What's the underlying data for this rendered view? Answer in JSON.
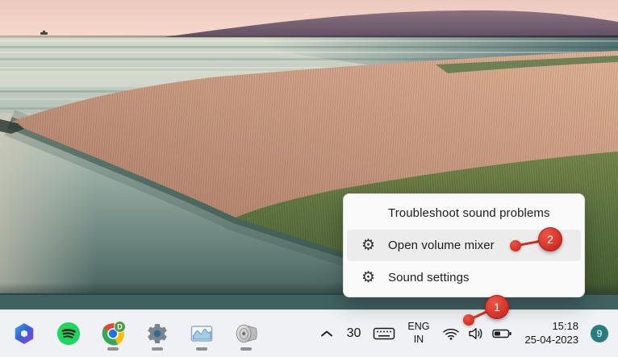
{
  "menu": {
    "items": [
      {
        "label": "Troubleshoot sound problems",
        "has_icon": false,
        "highlighted": false
      },
      {
        "label": "Open volume mixer",
        "has_icon": true,
        "highlighted": true
      },
      {
        "label": "Sound settings",
        "has_icon": true,
        "highlighted": false
      }
    ]
  },
  "taskbar": {
    "pinned_apps": [
      {
        "name": "microsoft-365",
        "running": false
      },
      {
        "name": "spotify",
        "running": false
      },
      {
        "name": "chrome",
        "running": true,
        "badge": "D"
      },
      {
        "name": "settings",
        "running": true
      },
      {
        "name": "task-manager",
        "running": true
      },
      {
        "name": "volume-app",
        "running": true
      }
    ],
    "status_number": "30",
    "language": {
      "line1": "ENG",
      "line2": "IN"
    },
    "clock": {
      "time": "15:18",
      "date": "25-04-2023"
    },
    "notification_count": "9"
  },
  "annotations": {
    "step1": {
      "number": "1"
    },
    "step2": {
      "number": "2"
    }
  },
  "icons": {
    "gear_glyph": "⚙",
    "names": [
      "gear-icon",
      "chevron-up-icon",
      "touch-keyboard-icon",
      "wifi-icon",
      "volume-icon",
      "battery-icon",
      "microsoft-365-icon",
      "spotify-icon",
      "chrome-icon",
      "settings-gear-icon",
      "task-manager-icon",
      "speaker-icon"
    ]
  },
  "colors": {
    "annotation_red": "#d9342b",
    "menu_bg": "#fafafa",
    "menu_highlight": "#ececec",
    "taskbar_bg": "#eff1f4",
    "badge_teal": "#2a7c80"
  }
}
